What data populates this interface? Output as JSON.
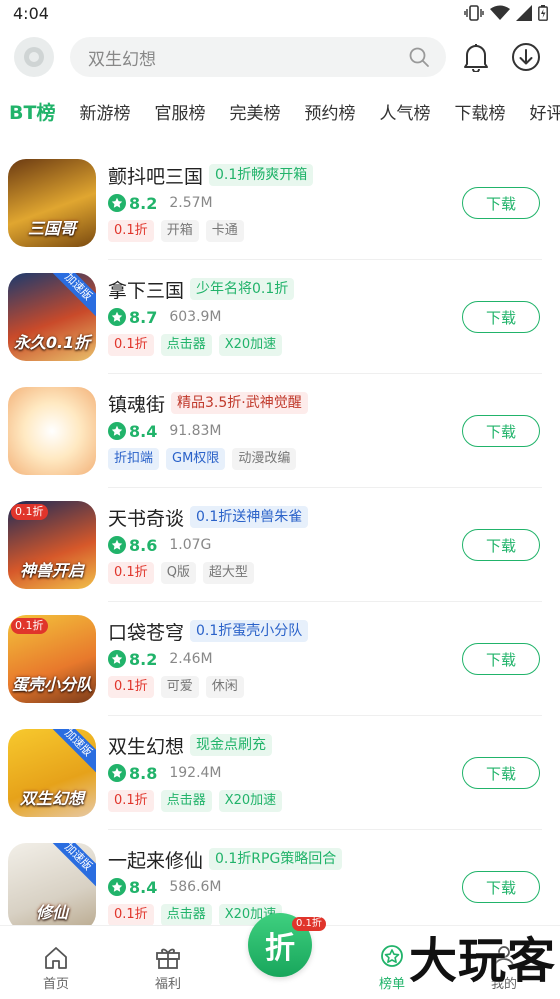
{
  "status": {
    "time": "4:04"
  },
  "search": {
    "placeholder": "双生幻想"
  },
  "tabs": [
    "BT榜",
    "新游榜",
    "官服榜",
    "完美榜",
    "预约榜",
    "人气榜",
    "下载榜",
    "好评"
  ],
  "download_label": "下载",
  "games": [
    {
      "name": "颤抖吧三国",
      "promo": "0.1折畅爽开箱",
      "promo_style": "green",
      "score": "8.2",
      "size": "2.57M",
      "tags": [
        {
          "t": "0.1折",
          "s": "red"
        },
        {
          "t": "开箱",
          "s": "gray"
        },
        {
          "t": "卡通",
          "s": "gray"
        }
      ],
      "icon": {
        "bg": "linear-gradient(160deg,#6b3a12,#e0a630 55%,#7a4a10)",
        "art": "三国哥",
        "ribbon": "",
        "badge": ""
      }
    },
    {
      "name": "拿下三国",
      "promo": "少年名将0.1折",
      "promo_style": "green",
      "score": "8.7",
      "size": "603.9M",
      "tags": [
        {
          "t": "0.1折",
          "s": "red"
        },
        {
          "t": "点击器",
          "s": "green"
        },
        {
          "t": "X20加速",
          "s": "green"
        }
      ],
      "icon": {
        "bg": "linear-gradient(160deg,#1b3a6e,#c94a2a 55%,#e9c16b)",
        "art": "永久0.1折",
        "ribbon": "加速版",
        "badge": ""
      }
    },
    {
      "name": "镇魂街",
      "promo": "精品3.5折·武神觉醒",
      "promo_style": "red",
      "score": "8.4",
      "size": "91.83M",
      "tags": [
        {
          "t": "折扣端",
          "s": "blue"
        },
        {
          "t": "GM权限",
          "s": "blue"
        },
        {
          "t": "动漫改编",
          "s": "gray"
        }
      ],
      "icon": {
        "bg": "radial-gradient(circle at 50% 50%,#ffffff,#ffe9c2 45%,#f3b27a)",
        "art": "",
        "ribbon": "",
        "badge": ""
      }
    },
    {
      "name": "天书奇谈",
      "promo": "0.1折送神兽朱雀",
      "promo_style": "blue",
      "score": "8.6",
      "size": "1.07G",
      "tags": [
        {
          "t": "0.1折",
          "s": "red"
        },
        {
          "t": "Q版",
          "s": "gray"
        },
        {
          "t": "超大型",
          "s": "gray"
        }
      ],
      "icon": {
        "bg": "linear-gradient(160deg,#1c2a58,#d6582a 60%,#f1c04a)",
        "art": "神兽开启",
        "ribbon": "",
        "badge": "0.1折"
      }
    },
    {
      "name": "口袋苍穹",
      "promo": "0.1折蛋壳小分队",
      "promo_style": "blue",
      "score": "8.2",
      "size": "2.46M",
      "tags": [
        {
          "t": "0.1折",
          "s": "red"
        },
        {
          "t": "可爱",
          "s": "gray"
        },
        {
          "t": "休闲",
          "s": "gray"
        }
      ],
      "icon": {
        "bg": "linear-gradient(160deg,#f3c33c,#e8792c 60%,#7a3b1a)",
        "art": "蛋壳小分队",
        "ribbon": "",
        "badge": "0.1折"
      }
    },
    {
      "name": "双生幻想",
      "promo": "现金点刷充",
      "promo_style": "green",
      "score": "8.8",
      "size": "192.4M",
      "tags": [
        {
          "t": "0.1折",
          "s": "red"
        },
        {
          "t": "点击器",
          "s": "green"
        },
        {
          "t": "X20加速",
          "s": "green"
        }
      ],
      "icon": {
        "bg": "linear-gradient(160deg,#f7c92e,#e6a21a 60%,#e7c9a6)",
        "art": "双生幻想",
        "ribbon": "加速版",
        "badge": ""
      }
    },
    {
      "name": "一起来修仙",
      "promo": "0.1折RPG策略回合",
      "promo_style": "green",
      "score": "8.4",
      "size": "586.6M",
      "tags": [
        {
          "t": "0.1折",
          "s": "red"
        },
        {
          "t": "点击器",
          "s": "green"
        },
        {
          "t": "X20加速",
          "s": "green"
        }
      ],
      "icon": {
        "bg": "linear-gradient(160deg,#f2efe8,#d8d1c4 60%,#b9a98e)",
        "art": "修仙",
        "ribbon": "加速版",
        "badge": ""
      }
    }
  ],
  "nav": {
    "home": "首页",
    "welfare": "福利",
    "center": "折",
    "center_badge": "0.1折",
    "rank": "榜单",
    "mine": "我的"
  },
  "watermark": "大玩客",
  "colors": {
    "accent": "#21b36a",
    "promo_red": "#e0352b",
    "promo_blue": "#2a62c9"
  }
}
